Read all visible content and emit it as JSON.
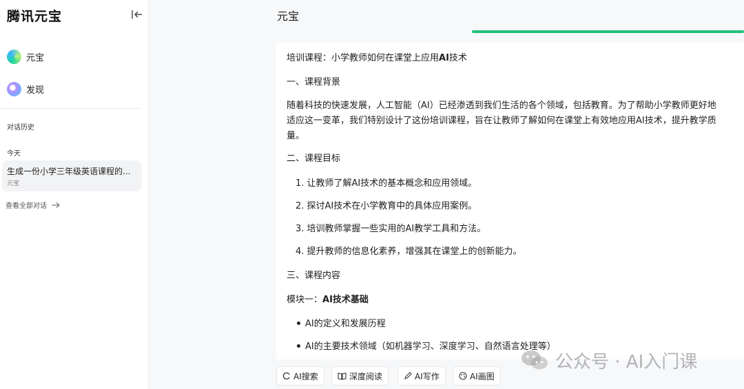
{
  "sidebar": {
    "brand": "腾讯元宝",
    "nav": [
      {
        "label": "元宝",
        "icon": "yuanbao-logo-icon"
      },
      {
        "label": "发现",
        "icon": "discover-sparkle-icon"
      }
    ],
    "history_title": "对话历史",
    "group_today": "今天",
    "history_items": [
      {
        "title": "生成一份小学三年级英语课程的...",
        "subtitle": "元宝"
      }
    ],
    "view_all": "查看全部对话"
  },
  "main": {
    "title": "元宝",
    "content": {
      "heading": "培训课程：小学教师如何在课堂上应用",
      "heading_bold": "AI",
      "heading_tail": "技术",
      "section1": "一、课程背景",
      "para1_line1": "随着科技的快速发展，人工智能（AI）已经渗透到我们生活的各个领域，包括教育。为了帮助小学教师更好地",
      "para1_line2": "适应这一变革，我们特别设计了这份培训课程，旨在让教师了解如何在课堂上有效地应用AI技术，提升教学质",
      "para1_line3": "量。",
      "section2": "二、课程目标",
      "goals": [
        "1. 让教师了解AI技术的基本概念和应用领域。",
        "2. 探讨AI技术在小学教育中的具体应用案例。",
        "3. 培训教师掌握一些实用的AI教学工具和方法。",
        "4. 提升教师的信息化素养，增强其在课堂上的创新能力。"
      ],
      "section3": "三、课程内容",
      "module1_prefix": "模块一：",
      "module1_bold": "AI技术基础",
      "bullets": [
        "AI的定义和发展历程",
        "AI的主要技术领域（如机器学习、深度学习、自然语言处理等）"
      ]
    },
    "toolbar": [
      {
        "label": "AI搜索",
        "icon": "ai-search-icon"
      },
      {
        "label": "深度阅读",
        "icon": "book-open-icon"
      },
      {
        "label": "AI写作",
        "icon": "pen-icon"
      },
      {
        "label": "AI画图",
        "icon": "palette-icon"
      }
    ]
  },
  "watermark": {
    "text": "公众号 · AI入门课",
    "icon": "wechat-logo-icon"
  },
  "colors": {
    "accent_green": "#22c27a",
    "sidebar_bg": "#ffffff",
    "page_bg": "#f7f8fa"
  }
}
